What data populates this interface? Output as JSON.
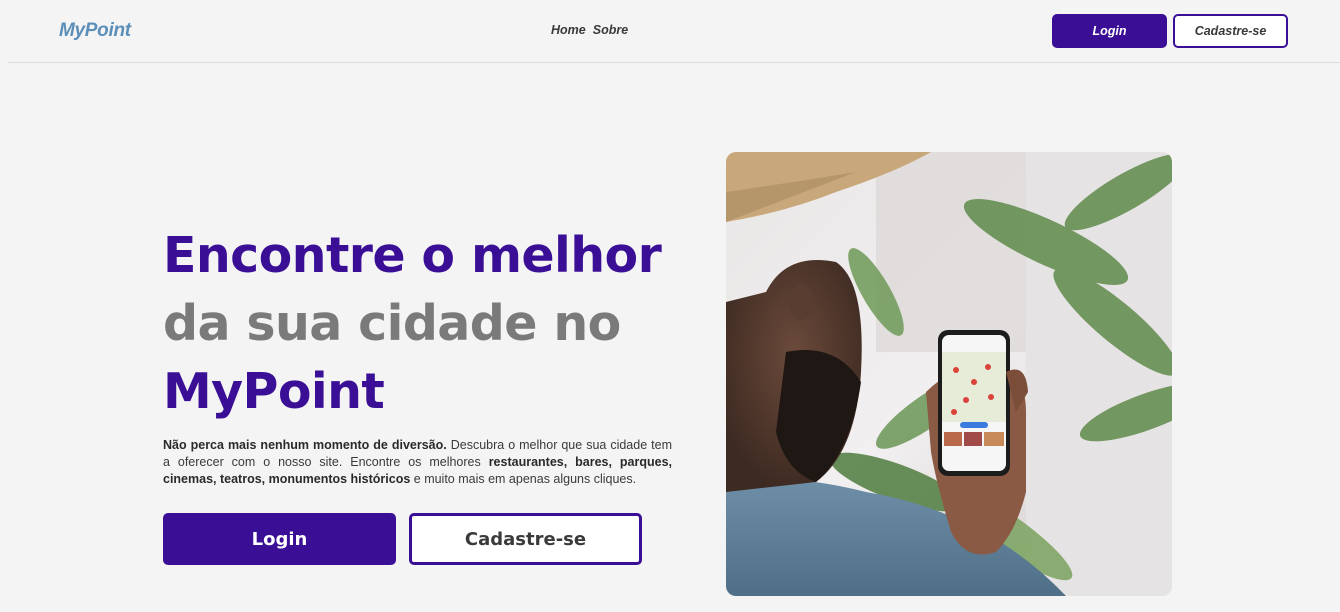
{
  "nav": {
    "brand": "MyPoint",
    "links": [
      "Home",
      "Sobre"
    ],
    "login_label": "Login",
    "signup_label": "Cadastre-se"
  },
  "hero": {
    "title_line1": "Encontre o melhor",
    "title_line2": "da sua cidade no",
    "title_line3": "MyPoint",
    "desc_bold1": "Não perca mais nenhum momento de diversão.",
    "desc_text1": " Descubra o melhor que sua cidade tem a oferecer com o nosso site. Encontre os melhores ",
    "desc_bold2": "restaurantes, bares, parques, cinemas, teatros, monumentos históricos",
    "desc_text2": " e muito mais em apenas alguns cliques.",
    "login_label": "Login",
    "signup_label": "Cadastre-se"
  },
  "colors": {
    "accent": "#3a0f96",
    "brand": "#5b8fb9",
    "muted": "#7a7a7a",
    "background": "#f4f4f4"
  },
  "image": {
    "subject": "man-holding-phone-with-map-app"
  }
}
